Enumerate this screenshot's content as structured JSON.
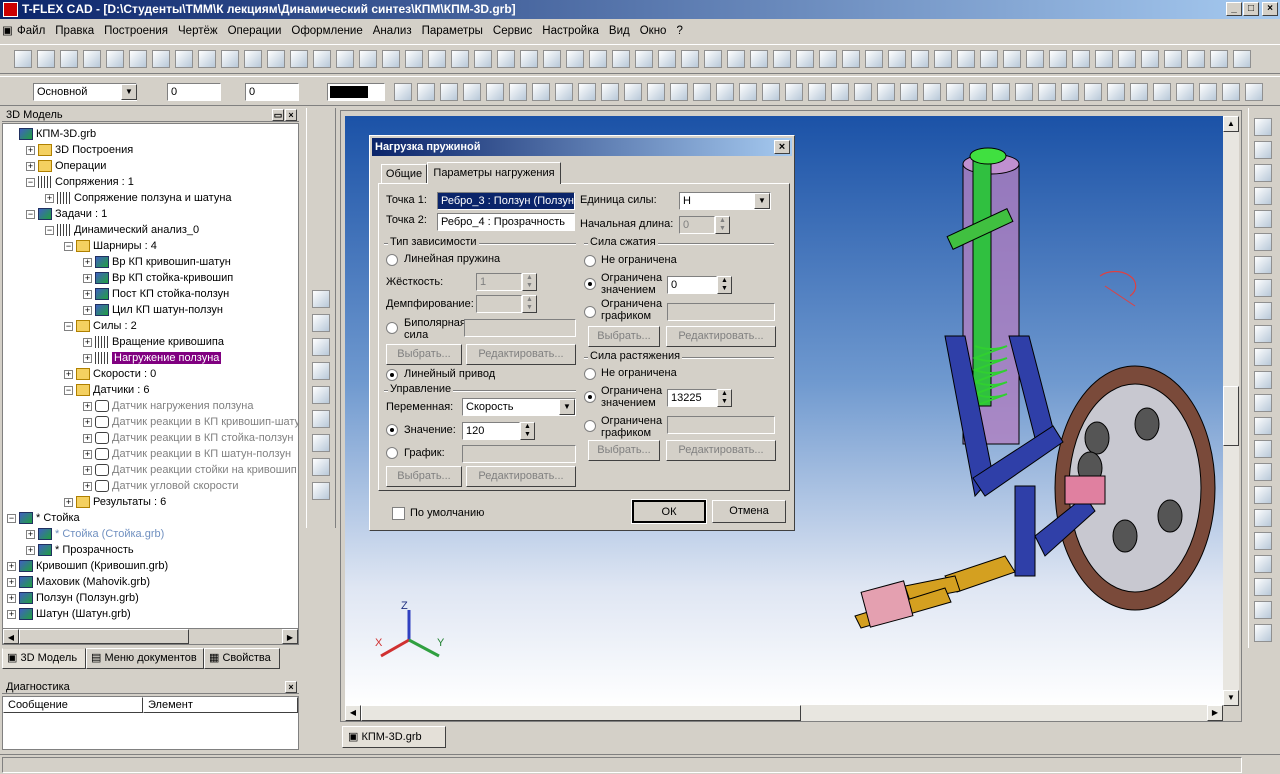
{
  "window": {
    "title": "T-FLEX CAD - [D:\\Студенты\\ТММ\\К лекциям\\Динамический синтез\\КПМ\\КПМ-3D.grb]"
  },
  "menu": [
    "Файл",
    "Правка",
    "Построения",
    "Чертёж",
    "Операции",
    "Оформление",
    "Анализ",
    "Параметры",
    "Сервис",
    "Настройка",
    "Вид",
    "Окно",
    "?"
  ],
  "toolbar2": {
    "layer": "Основной",
    "value1": "0",
    "value2": "0"
  },
  "tree_panel": {
    "title": "3D Модель",
    "rows": [
      {
        "label": "КПМ-3D.grb",
        "indent": 0,
        "icon": "doc",
        "exp": ""
      },
      {
        "label": "3D Построения",
        "indent": 1,
        "icon": "folder",
        "exp": "+"
      },
      {
        "label": "Операции",
        "indent": 1,
        "icon": "folder",
        "exp": "+"
      },
      {
        "label": "Сопряжения : 1",
        "indent": 1,
        "icon": "spring",
        "exp": "-"
      },
      {
        "label": "Сопряжение ползуна и шатуна",
        "indent": 2,
        "icon": "spring",
        "exp": "+"
      },
      {
        "label": "Задачи : 1",
        "indent": 1,
        "icon": "cube",
        "exp": "-"
      },
      {
        "label": "Динамический анализ_0",
        "indent": 2,
        "icon": "spring",
        "exp": "-"
      },
      {
        "label": "Шарниры : 4",
        "indent": 3,
        "icon": "folder",
        "exp": "-"
      },
      {
        "label": "Вр КП кривошип-шатун",
        "indent": 4,
        "icon": "cube",
        "exp": "+"
      },
      {
        "label": "Вр КП стойка-кривошип",
        "indent": 4,
        "icon": "cube",
        "exp": "+"
      },
      {
        "label": "Пост КП стойка-ползун",
        "indent": 4,
        "icon": "cube",
        "exp": "+"
      },
      {
        "label": "Цил КП шатун-ползун",
        "indent": 4,
        "icon": "cube",
        "exp": "+"
      },
      {
        "label": "Силы : 2",
        "indent": 3,
        "icon": "folder",
        "exp": "-"
      },
      {
        "label": "Вращение кривошипа",
        "indent": 4,
        "icon": "spring",
        "exp": "+"
      },
      {
        "label": "Нагружение ползуна",
        "indent": 4,
        "icon": "spring",
        "exp": "+",
        "selected": true
      },
      {
        "label": "Скорости : 0",
        "indent": 3,
        "icon": "folder",
        "exp": "+"
      },
      {
        "label": "Датчики : 6",
        "indent": 3,
        "icon": "folder",
        "exp": "-"
      },
      {
        "label": "Датчик нагружения ползуна",
        "indent": 4,
        "icon": "sensor",
        "exp": "+",
        "grey": true
      },
      {
        "label": "Датчик реакции в КП кривошип-шатун",
        "indent": 4,
        "icon": "sensor",
        "exp": "+",
        "grey": true
      },
      {
        "label": "Датчик реакции в КП стойка-ползун",
        "indent": 4,
        "icon": "sensor",
        "exp": "+",
        "grey": true
      },
      {
        "label": "Датчик реакции в КП шатун-ползун",
        "indent": 4,
        "icon": "sensor",
        "exp": "+",
        "grey": true
      },
      {
        "label": "Датчик реакции стойки на кривошип",
        "indent": 4,
        "icon": "sensor",
        "exp": "+",
        "grey": true
      },
      {
        "label": "Датчик угловой скорости",
        "indent": 4,
        "icon": "sensor",
        "exp": "+",
        "grey": true
      },
      {
        "label": "Результаты : 6",
        "indent": 3,
        "icon": "folder",
        "exp": "+"
      },
      {
        "label": "* Стойка",
        "indent": 0,
        "icon": "cube",
        "exp": "-"
      },
      {
        "label": "* Стойка (Стойка.grb)",
        "indent": 1,
        "icon": "cube",
        "exp": "+",
        "blue": true
      },
      {
        "label": "* Прозрачность",
        "indent": 1,
        "icon": "cube",
        "exp": "+"
      },
      {
        "label": "Кривошип (Кривошип.grb)",
        "indent": 0,
        "icon": "cube",
        "exp": "+"
      },
      {
        "label": "Маховик (Mahovik.grb)",
        "indent": 0,
        "icon": "cube",
        "exp": "+"
      },
      {
        "label": "Ползун (Ползун.grb)",
        "indent": 0,
        "icon": "cube",
        "exp": "+"
      },
      {
        "label": "Шатун (Шатун.grb)",
        "indent": 0,
        "icon": "cube",
        "exp": "+"
      }
    ]
  },
  "panel_tabs": [
    "3D Модель",
    "Меню документов",
    "Свойства"
  ],
  "diagnostics": {
    "title": "Диагностика",
    "col1": "Сообщение",
    "col2": "Элемент"
  },
  "doc_tab": "КПМ-3D.grb",
  "axes": {
    "x": "X",
    "y": "Y",
    "z": "Z"
  },
  "dialog": {
    "title": "Нагрузка пружиной",
    "tabs": [
      "Общие",
      "Параметры нагружения"
    ],
    "point1_label": "Точка 1:",
    "point1_value": "Ребро_3 : Ползун (Ползун.",
    "point2_label": "Точка 2:",
    "point2_value": "Ребро_4 : Прозрачность",
    "force_unit_label": "Единица силы:",
    "force_unit_value": "Н",
    "initial_length_label": "Начальная длина:",
    "initial_length_value": "0",
    "dep_group": "Тип зависимости",
    "linear_spring": "Линейная пружина",
    "stiffness_label": "Жёсткость:",
    "stiffness_value": "1",
    "damping_label": "Демпфирование:",
    "damping_value": "",
    "bipolar_label": "Биполярная сила",
    "select_btn": "Выбрать...",
    "edit_btn": "Редактировать...",
    "linear_drive": "Линейный привод",
    "control_group": "Управление",
    "variable_label": "Переменная:",
    "variable_value": "Скорость",
    "value_label": "Значение:",
    "value_value": "120",
    "graph_label": "График:",
    "compression_group": "Сила сжатия",
    "not_limited": "Не ограничена",
    "limited_value": "Ограничена значением",
    "compression_value": "0",
    "limited_graph": "Ограничена графиком",
    "tension_group": "Сила растяжения",
    "tension_value": "13225",
    "default_label": "По умолчанию",
    "ok": "ОК",
    "cancel": "Отмена"
  }
}
